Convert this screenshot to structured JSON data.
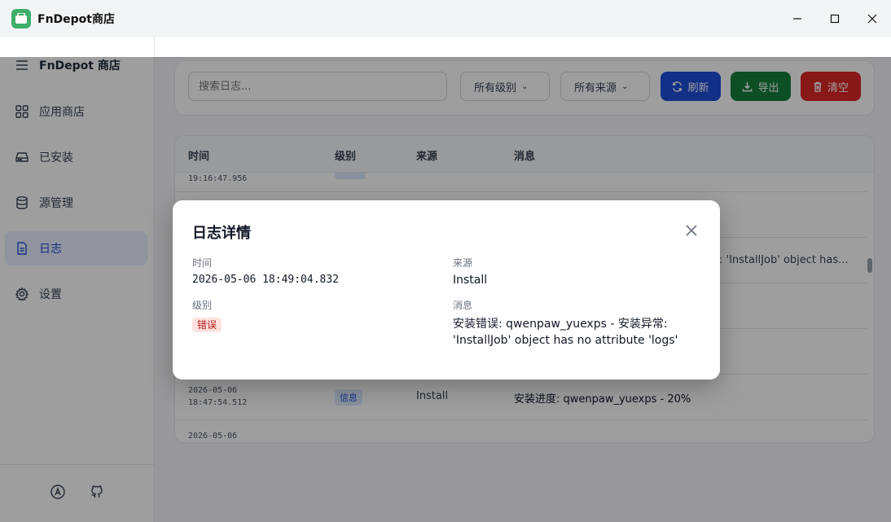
{
  "window": {
    "title": "FnDepot商店"
  },
  "sidebar": {
    "header": "FnDepot 商店",
    "items": [
      {
        "label": "应用商店",
        "icon": "grid-icon"
      },
      {
        "label": "已安装",
        "icon": "drive-icon"
      },
      {
        "label": "源管理",
        "icon": "database-icon"
      },
      {
        "label": "日志",
        "icon": "document-icon",
        "active": true
      },
      {
        "label": "设置",
        "icon": "gear-icon"
      }
    ]
  },
  "toolbar": {
    "search_placeholder": "搜索日志...",
    "level_filter": "所有级别",
    "source_filter": "所有来源",
    "refresh_label": "刷新",
    "export_label": "导出",
    "clear_label": "清空"
  },
  "table": {
    "headers": [
      "时间",
      "级别",
      "来源",
      "消息"
    ],
    "top_row_time": "19:16:47.956",
    "visible_row": {
      "date": "2026-05-06",
      "time": "18:47:54.512",
      "level": "信息",
      "source": "Install",
      "message": "安装进度: qwenpaw_yuexps - 20%"
    },
    "partial_row_message": ": 'InstallJob' object has...",
    "bottom_row_date": "2026-05-06"
  },
  "modal": {
    "title": "日志详情",
    "time_label": "时间",
    "time_value": "2026-05-06 18:49:04.832",
    "source_label": "来源",
    "source_value": "Install",
    "level_label": "级别",
    "level_value": "错误",
    "message_label": "消息",
    "message_line1": "安装错误: qwenpaw_yuexps - 安装异常:",
    "message_line2": "'InstallJob' object has no attribute 'logs'"
  },
  "colors": {
    "refresh": "#1d4ed8",
    "export": "#15803d",
    "clear": "#dc2626",
    "accent": "#1d4ed8"
  }
}
